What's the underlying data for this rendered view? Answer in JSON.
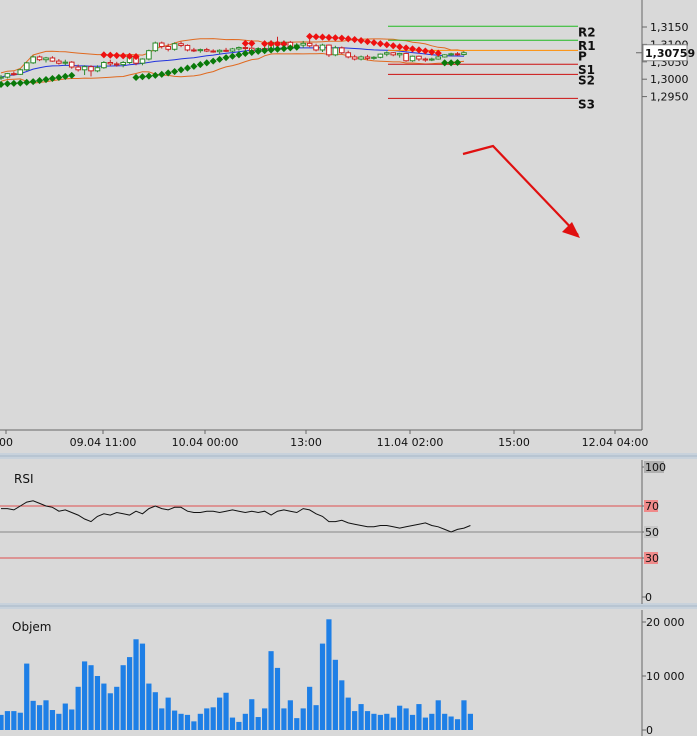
{
  "chart_data": [
    {
      "type": "candlestick",
      "panel": "price",
      "x_tick_labels": [
        "00",
        "09.04 11:00",
        "10.04 00:00",
        "13:00",
        "11.04 02:00",
        "15:00",
        "12.04 04:00"
      ],
      "y_ticks": [
        "1,2950",
        "1,3000",
        "1,3050",
        "1,3100",
        "1,3150"
      ],
      "ylim": [
        1.292,
        1.3165
      ],
      "current_price_label": "1,30759",
      "pivot_levels": [
        {
          "label": "R2",
          "value": 1.3152,
          "color": "#22bb22"
        },
        {
          "label": "R1",
          "value": 1.3112,
          "color": "#22bb22"
        },
        {
          "label": "P",
          "value": 1.3083,
          "color": "#ff8c00"
        },
        {
          "label": "S1",
          "value": 1.3043,
          "color": "#cc1111"
        },
        {
          "label": "S2",
          "value": 1.3014,
          "color": "#cc1111"
        },
        {
          "label": "S3",
          "value": 1.2945,
          "color": "#cc1111"
        }
      ],
      "candles": [
        [
          1.3003,
          1.3012,
          1.2998,
          1.3006
        ],
        [
          1.3006,
          1.3018,
          1.3002,
          1.3016
        ],
        [
          1.3016,
          1.3022,
          1.301,
          1.3014
        ],
        [
          1.3014,
          1.303,
          1.3012,
          1.3027
        ],
        [
          1.3027,
          1.305,
          1.3024,
          1.3047
        ],
        [
          1.3047,
          1.3068,
          1.3044,
          1.3064
        ],
        [
          1.3064,
          1.3068,
          1.3052,
          1.3056
        ],
        [
          1.3056,
          1.3064,
          1.3048,
          1.3061
        ],
        [
          1.3061,
          1.3066,
          1.305,
          1.3052
        ],
        [
          1.3052,
          1.3058,
          1.3042,
          1.3046
        ],
        [
          1.3046,
          1.3056,
          1.304,
          1.3049
        ],
        [
          1.3049,
          1.3052,
          1.303,
          1.3035
        ],
        [
          1.3035,
          1.3042,
          1.3022,
          1.3027
        ],
        [
          1.3027,
          1.304,
          1.3012,
          1.3036
        ],
        [
          1.3036,
          1.304,
          1.3008,
          1.3024
        ],
        [
          1.3024,
          1.304,
          1.302,
          1.3033
        ],
        [
          1.3033,
          1.3052,
          1.303,
          1.3048
        ],
        [
          1.3048,
          1.3056,
          1.3038,
          1.3044
        ],
        [
          1.3044,
          1.305,
          1.3036,
          1.3042
        ],
        [
          1.3042,
          1.3052,
          1.3034,
          1.3048
        ],
        [
          1.3048,
          1.307,
          1.3044,
          1.3066
        ],
        [
          1.3066,
          1.307,
          1.304,
          1.3046
        ],
        [
          1.3046,
          1.306,
          1.304,
          1.3058
        ],
        [
          1.3058,
          1.3085,
          1.3054,
          1.3082
        ],
        [
          1.3082,
          1.3108,
          1.3078,
          1.3104
        ],
        [
          1.3104,
          1.3108,
          1.3088,
          1.3094
        ],
        [
          1.3094,
          1.3102,
          1.308,
          1.3086
        ],
        [
          1.3086,
          1.3106,
          1.3082,
          1.3102
        ],
        [
          1.3102,
          1.3108,
          1.3092,
          1.3097
        ],
        [
          1.3097,
          1.31,
          1.308,
          1.3084
        ],
        [
          1.3084,
          1.309,
          1.3078,
          1.3082
        ],
        [
          1.3082,
          1.3088,
          1.3076,
          1.3085
        ],
        [
          1.3085,
          1.309,
          1.3078,
          1.3081
        ],
        [
          1.3081,
          1.3086,
          1.3076,
          1.3079
        ],
        [
          1.3079,
          1.3086,
          1.3072,
          1.3083
        ],
        [
          1.3083,
          1.309,
          1.3078,
          1.3081
        ],
        [
          1.3081,
          1.309,
          1.3078,
          1.3087
        ],
        [
          1.3087,
          1.3094,
          1.3082,
          1.3091
        ],
        [
          1.3091,
          1.3096,
          1.3084,
          1.3089
        ],
        [
          1.3089,
          1.3094,
          1.3078,
          1.3082
        ],
        [
          1.3082,
          1.3092,
          1.3076,
          1.3088
        ],
        [
          1.3088,
          1.3098,
          1.308,
          1.3084
        ],
        [
          1.3084,
          1.3112,
          1.308,
          1.3106
        ],
        [
          1.3106,
          1.3122,
          1.3094,
          1.3099
        ],
        [
          1.3099,
          1.3112,
          1.309,
          1.3106
        ],
        [
          1.3106,
          1.311,
          1.309,
          1.3094
        ],
        [
          1.3094,
          1.3104,
          1.3088,
          1.3098
        ],
        [
          1.3098,
          1.311,
          1.309,
          1.3103
        ],
        [
          1.3103,
          1.3114,
          1.3092,
          1.3096
        ],
        [
          1.3096,
          1.3102,
          1.308,
          1.3084
        ],
        [
          1.3084,
          1.3102,
          1.3078,
          1.3098
        ],
        [
          1.3098,
          1.31,
          1.3064,
          1.307
        ],
        [
          1.307,
          1.3096,
          1.3066,
          1.309
        ],
        [
          1.309,
          1.3094,
          1.3072,
          1.3076
        ],
        [
          1.3076,
          1.3082,
          1.306,
          1.3064
        ],
        [
          1.3064,
          1.307,
          1.3054,
          1.3058
        ],
        [
          1.3058,
          1.3068,
          1.3054,
          1.3064
        ],
        [
          1.3064,
          1.307,
          1.3054,
          1.306
        ],
        [
          1.306,
          1.3066,
          1.3056,
          1.3063
        ],
        [
          1.3063,
          1.3074,
          1.306,
          1.3072
        ],
        [
          1.3072,
          1.308,
          1.3066,
          1.3076
        ],
        [
          1.3076,
          1.3078,
          1.3066,
          1.307
        ],
        [
          1.307,
          1.3076,
          1.3062,
          1.3074
        ],
        [
          1.3074,
          1.3076,
          1.305,
          1.3053
        ],
        [
          1.3053,
          1.3068,
          1.305,
          1.3066
        ],
        [
          1.3066,
          1.3068,
          1.3052,
          1.3058
        ],
        [
          1.3058,
          1.3062,
          1.305,
          1.3055
        ],
        [
          1.3055,
          1.3062,
          1.3052,
          1.3058
        ],
        [
          1.3058,
          1.3066,
          1.3056,
          1.3064
        ],
        [
          1.3064,
          1.3072,
          1.3062,
          1.307
        ],
        [
          1.307,
          1.3076,
          1.3066,
          1.3073
        ],
        [
          1.3073,
          1.3078,
          1.3068,
          1.3071
        ],
        [
          1.3071,
          1.308,
          1.3068,
          1.3076
        ]
      ],
      "volume_bars_note": "see volume panel",
      "parabolic_sar": {
        "bear": [
          [
            16,
            1.307
          ],
          [
            17,
            1.3069
          ],
          [
            18,
            1.3068
          ],
          [
            19,
            1.3067
          ],
          [
            20,
            1.3066
          ],
          [
            21,
            1.3065
          ],
          [
            38,
            1.3103
          ],
          [
            39,
            1.3103
          ],
          [
            41,
            1.3102
          ],
          [
            42,
            1.3102
          ],
          [
            43,
            1.3101
          ],
          [
            44,
            1.3101
          ],
          [
            48,
            1.3123
          ],
          [
            49,
            1.3122
          ],
          [
            50,
            1.3121
          ],
          [
            51,
            1.312
          ],
          [
            52,
            1.3119
          ],
          [
            53,
            1.3118
          ],
          [
            54,
            1.3116
          ],
          [
            55,
            1.3114
          ],
          [
            56,
            1.3111
          ],
          [
            57,
            1.3108
          ],
          [
            58,
            1.3105
          ],
          [
            59,
            1.3102
          ],
          [
            60,
            1.3099
          ],
          [
            61,
            1.3096
          ],
          [
            62,
            1.3093
          ],
          [
            63,
            1.309
          ],
          [
            64,
            1.3087
          ],
          [
            65,
            1.3084
          ],
          [
            66,
            1.3081
          ],
          [
            67,
            1.3078
          ],
          [
            68,
            1.3075
          ]
        ],
        "bull": [
          [
            0,
            1.2985
          ],
          [
            1,
            1.2987
          ],
          [
            2,
            1.2988
          ],
          [
            3,
            1.2989
          ],
          [
            4,
            1.2991
          ],
          [
            5,
            1.2993
          ],
          [
            6,
            1.2996
          ],
          [
            7,
            1.2999
          ],
          [
            8,
            1.3002
          ],
          [
            9,
            1.3005
          ],
          [
            10,
            1.3008
          ],
          [
            11,
            1.3011
          ],
          [
            21,
            1.3005
          ],
          [
            22,
            1.3007
          ],
          [
            23,
            1.3009
          ],
          [
            24,
            1.3011
          ],
          [
            25,
            1.3014
          ],
          [
            26,
            1.3018
          ],
          [
            27,
            1.3022
          ],
          [
            28,
            1.3027
          ],
          [
            29,
            1.3032
          ],
          [
            30,
            1.3037
          ],
          [
            31,
            1.3042
          ],
          [
            32,
            1.3047
          ],
          [
            33,
            1.3052
          ],
          [
            34,
            1.3057
          ],
          [
            35,
            1.3062
          ],
          [
            36,
            1.3066
          ],
          [
            37,
            1.307
          ],
          [
            38,
            1.3074
          ],
          [
            39,
            1.3077
          ],
          [
            40,
            1.308
          ],
          [
            41,
            1.3082
          ],
          [
            42,
            1.3084
          ],
          [
            43,
            1.3086
          ],
          [
            44,
            1.3088
          ],
          [
            45,
            1.309
          ],
          [
            46,
            1.3092
          ],
          [
            69,
            1.3047
          ],
          [
            70,
            1.3047
          ],
          [
            71,
            1.3048
          ]
        ]
      }
    },
    {
      "type": "line",
      "panel": "rsi",
      "title": "RSI",
      "y_ticks": [
        "100",
        "70",
        "50",
        "30",
        "0"
      ],
      "ylim": [
        0,
        100
      ],
      "reference_levels": [
        70,
        50,
        30
      ],
      "values": [
        68,
        68,
        67,
        70,
        73,
        74,
        72,
        70,
        69,
        66,
        67,
        65,
        63,
        60,
        58,
        62,
        64,
        63,
        65,
        64,
        63,
        66,
        64,
        68,
        70,
        68,
        67,
        69,
        69,
        66,
        65,
        65,
        66,
        66,
        65,
        66,
        67,
        66,
        65,
        66,
        65,
        66,
        63,
        66,
        67,
        66,
        65,
        68,
        67,
        64,
        62,
        58,
        58,
        59,
        57,
        56,
        55,
        54,
        54,
        55,
        55,
        54,
        53,
        54,
        55,
        56,
        57,
        55,
        54,
        52,
        50,
        52,
        53,
        55
      ]
    },
    {
      "type": "bar",
      "panel": "volume",
      "title": "Objem",
      "y_ticks": [
        "20 000",
        "10 000",
        "0"
      ],
      "ylim": [
        0,
        22500
      ],
      "values": [
        2800,
        3500,
        3500,
        3200,
        12300,
        5400,
        4600,
        5500,
        3700,
        3000,
        4900,
        3800,
        8000,
        12700,
        12000,
        10000,
        8600,
        6800,
        8000,
        12000,
        13500,
        16800,
        16000,
        8600,
        7000,
        4000,
        6000,
        3600,
        3000,
        2800,
        1600,
        3000,
        4000,
        4200,
        6000,
        6900,
        2300,
        1500,
        3000,
        5700,
        2400,
        4000,
        14600,
        11500,
        4000,
        5500,
        2200,
        4000,
        8000,
        4600,
        16000,
        20500,
        13000,
        9200,
        6000,
        3500,
        4800,
        3500,
        3000,
        2800,
        3000,
        2300,
        4500,
        4000,
        2800,
        4800,
        2300,
        3000,
        5500,
        3000,
        2500,
        2000,
        5500,
        3000
      ]
    }
  ]
}
